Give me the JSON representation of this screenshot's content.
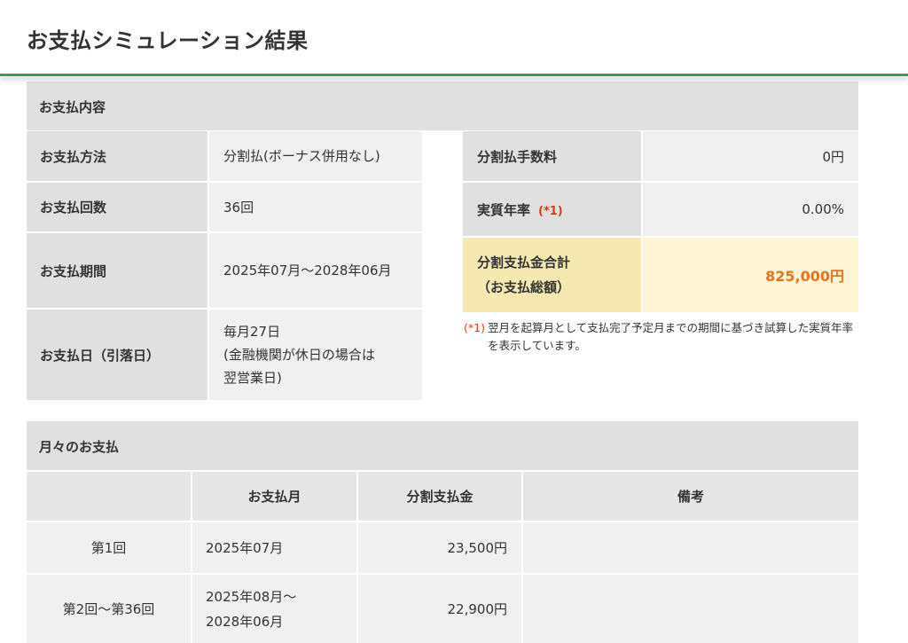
{
  "header": {
    "title": "お支払シミュレーション結果",
    "accent": "#3d9a5e"
  },
  "payment_details": {
    "section_title": "お支払内容",
    "left_rows": [
      {
        "label": "お支払方法",
        "value": "分割払(ボーナス併用なし)"
      },
      {
        "label": "お支払回数",
        "value": "36回"
      },
      {
        "label": "お支払期間",
        "value": "2025年07月～2028年06月"
      },
      {
        "label": "お支払日（引落日）",
        "value_lines": [
          "毎月27日",
          "(金融機関が休日の場合は",
          "翌営業日)"
        ]
      }
    ],
    "right_rows": [
      {
        "label": "分割払手数料",
        "value": "0円"
      },
      {
        "label": "実質年率",
        "note_mark": "(*1)",
        "value": "0.00%"
      }
    ],
    "total": {
      "label_line1": "分割支払金合計",
      "label_line2": "（お支払総額）",
      "value": "825,000円",
      "color": "#e8731e"
    },
    "footnote": {
      "mark": "(*1)",
      "text": "翌月を起算月として支払完了予定月までの期間に基づき試算した実質年率を表示しています。"
    }
  },
  "monthly": {
    "section_title": "月々のお支払",
    "headers": [
      "",
      "お支払月",
      "分割支払金",
      "備考"
    ],
    "rows": [
      {
        "no": "第1回",
        "month_lines": [
          "2025年07月"
        ],
        "amount": "23,500円",
        "remarks": ""
      },
      {
        "no": "第2回～第36回",
        "month_lines": [
          "2025年08月～",
          "2028年06月"
        ],
        "amount": "22,900円",
        "remarks": ""
      }
    ]
  }
}
